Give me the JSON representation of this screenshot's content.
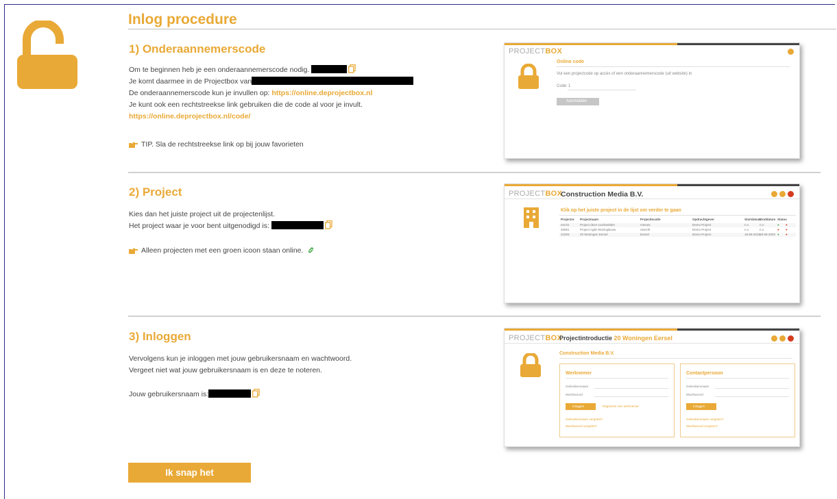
{
  "page": {
    "title": "Inlog procedure",
    "accent": "#e9a936"
  },
  "section1": {
    "heading": "1) Onderaannemerscode",
    "line1": "Om te beginnen heb je een onderaannemerscode nodig.",
    "line2": "Je komt daarmee in de Projectbox van",
    "line3_prefix": "De onderaannemerscode kun je invullen op:",
    "line3_link": "https://online.deprojectbox.nl",
    "line4": "Je kunt ook een rechtstreekse link gebruiken die de code al voor je invult.",
    "direct_link": "https://online.deprojectbox.nl/code/",
    "tip": "TIP. Sla de rechtstreekse link op bij jouw favorieten",
    "shot": {
      "brand_light": "PROJECT",
      "brand_bold": "BOX",
      "heading": "Online code",
      "description": "Vul een projectcode op accès of een onderaannemerscode (uit website) in",
      "code_label": "Code",
      "code_value": "1",
      "submit": "Aanmelden"
    }
  },
  "section2": {
    "heading": "2) Project",
    "line1": "Kies dan het juiste project uit de projectenlijst.",
    "line2": "Het project waar je voor bent uitgenodigd is:",
    "note": "Alleen projecten met een groen icoon staan online.",
    "shot": {
      "brand_light": "PROJECT",
      "brand_bold": "BOX",
      "company": "Construction Media B.V.",
      "heading": "Klik op het juiste project in de lijst om verder te gaan",
      "columns": [
        "Projectnr",
        "Projectnaam",
        "Projectlocatie",
        "Opdrachtgever",
        "Startdatum",
        "Einddatum",
        "Status"
      ],
      "rows": [
        [
          "ext-01",
          "Project deze voorbeelden",
          "meeuw",
          "Demo Project",
          "n.v.",
          "n.v."
        ],
        [
          "20001",
          "Project Agile Woningbouw",
          "Utrecht",
          "Demo Project",
          "n.v.",
          "n.v."
        ],
        [
          "21003",
          "20 Woningen Eersel",
          "Eersel",
          "Demo Project",
          "18-06-2019",
          "18-06-2020"
        ]
      ]
    }
  },
  "section3": {
    "heading": "3) Inloggen",
    "line1": "Vervolgens kun je inloggen met jouw gebruikersnaam en wachtwoord.",
    "line2": "Vergeet niet wat jouw gebruikersnaam is en deze te noteren.",
    "line3": "Jouw gebruikersnaam is:",
    "shot": {
      "brand_light": "PROJECT",
      "brand_bold": "BOX",
      "intro_label": "Projectintroductie",
      "project_name": "20 Woningen Eersel",
      "company": "Construction Media B.V.",
      "panel_left_title": "Werknemer",
      "panel_right_title": "Contactpersoon",
      "username_label": "Gebruikersnaam",
      "password_label": "Wachtwoord",
      "login_button": "Inloggen",
      "register_link": "Registreer een werknemer",
      "forgot_user": "Gebruikersnaam vergeten?",
      "forgot_password": "Wachtwoord vergeten?"
    }
  },
  "cta": {
    "label": "Ik snap het"
  }
}
